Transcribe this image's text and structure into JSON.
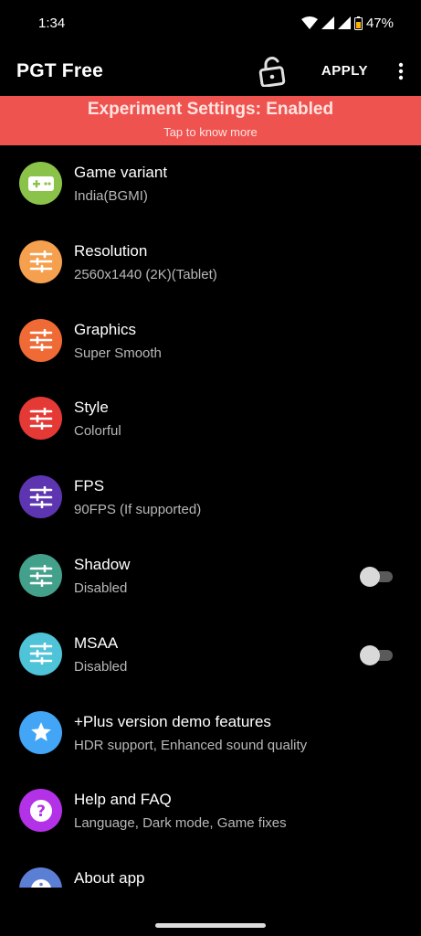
{
  "status": {
    "time": "1:34",
    "battery": "47%"
  },
  "appbar": {
    "title": "PGT Free",
    "apply_label": "APPLY"
  },
  "banner": {
    "title": "Experiment Settings: Enabled",
    "subtitle": "Tap to know more",
    "color": "#ef5350"
  },
  "settings": [
    {
      "title": "Game variant",
      "subtitle": "India(BGMI)",
      "icon": "gamepad-icon",
      "color": "#8bc34a"
    },
    {
      "title": "Resolution",
      "subtitle": "2560x1440 (2K)(Tablet)",
      "icon": "sliders-icon",
      "color": "#f5a04e"
    },
    {
      "title": "Graphics",
      "subtitle": "Super Smooth",
      "icon": "sliders-icon",
      "color": "#f06a36"
    },
    {
      "title": "Style",
      "subtitle": "Colorful",
      "icon": "sliders-icon",
      "color": "#e53935"
    },
    {
      "title": "FPS",
      "subtitle": "90FPS (If supported)",
      "icon": "sliders-icon",
      "color": "#5e35b1"
    },
    {
      "title": "Shadow",
      "subtitle": "Disabled",
      "icon": "sliders-icon",
      "color": "#43a08a",
      "toggle": false
    },
    {
      "title": "MSAA",
      "subtitle": "Disabled",
      "icon": "sliders-icon",
      "color": "#4fc3d7",
      "toggle": false
    },
    {
      "title": "+Plus version demo features",
      "subtitle": "HDR support, Enhanced sound quality",
      "icon": "star-icon",
      "color": "#42a5f5"
    },
    {
      "title": "Help and FAQ",
      "subtitle": "Language, Dark mode, Game fixes",
      "icon": "help-icon",
      "color": "#b331e6"
    },
    {
      "title": "About app",
      "subtitle": "",
      "icon": "info-icon",
      "color": "#5c7fd6"
    }
  ]
}
